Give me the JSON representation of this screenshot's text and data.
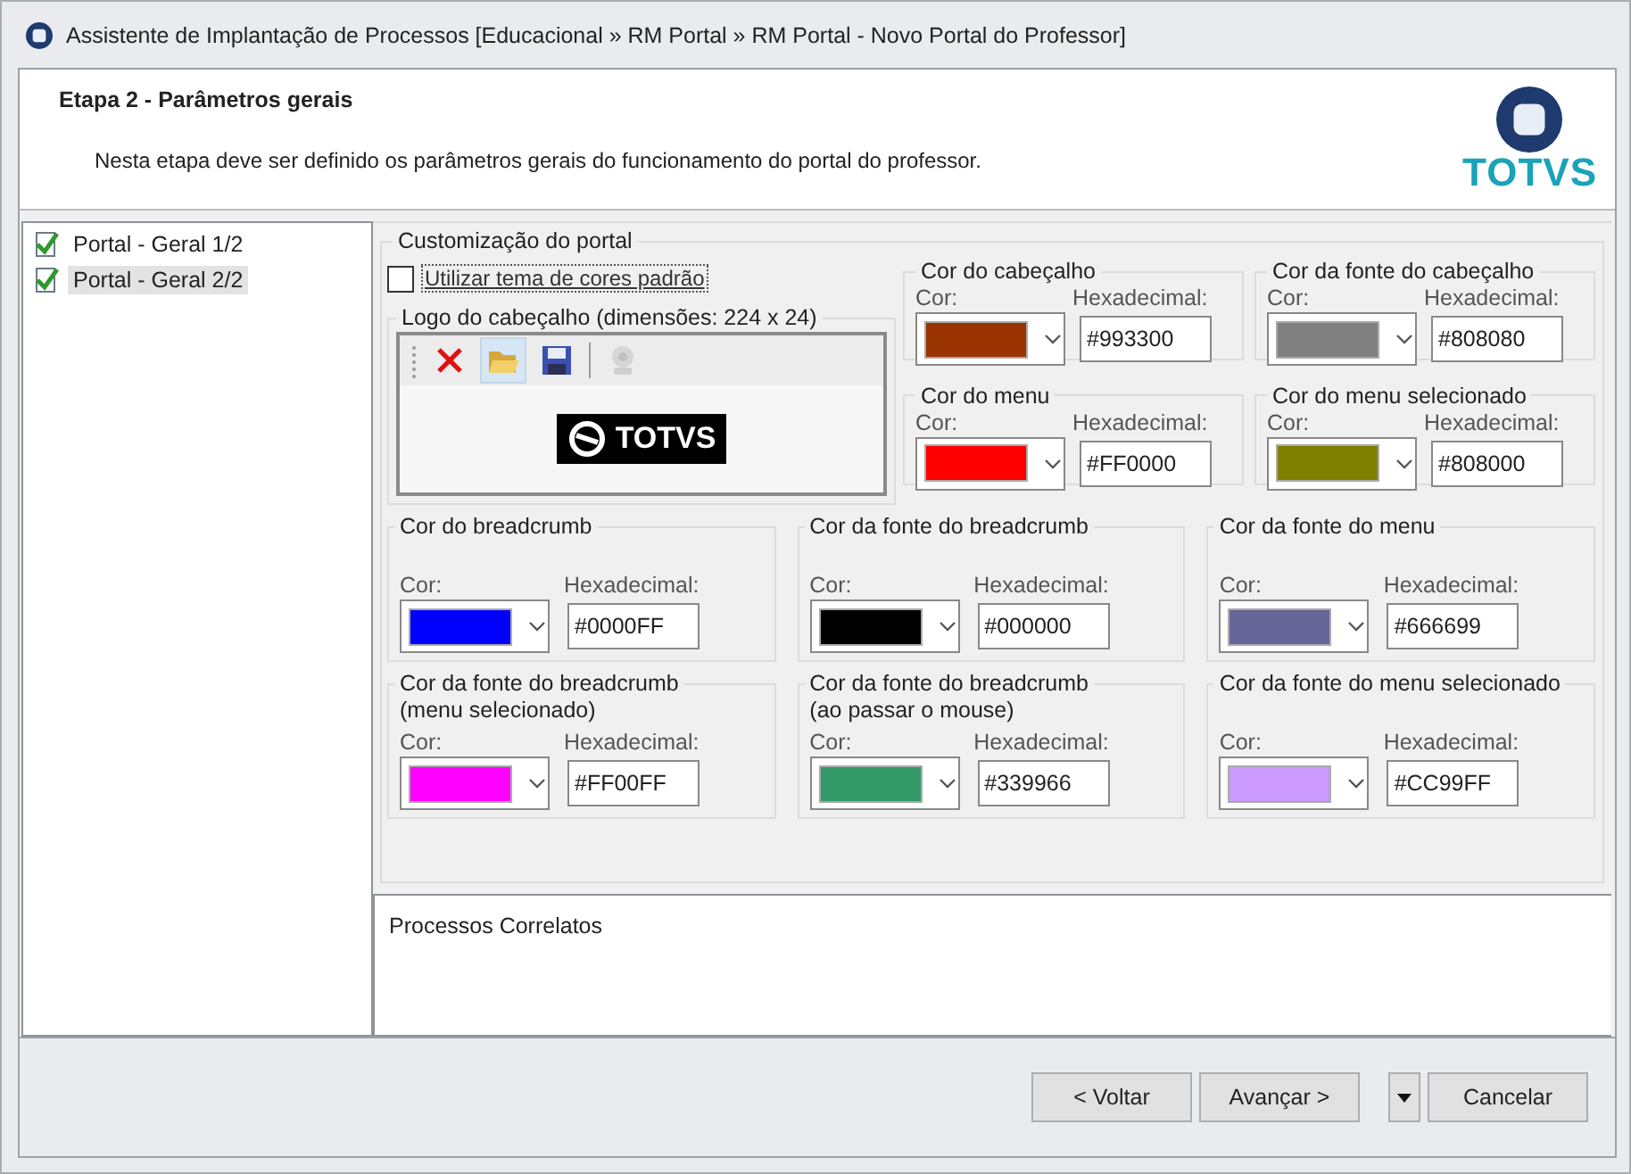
{
  "window": {
    "title": "Assistente de Implantação de Processos [Educacional » RM Portal » RM Portal - Novo Portal do Professor]"
  },
  "header": {
    "title": "Etapa 2 - Parâmetros gerais",
    "description": "Nesta etapa deve ser definido os parâmetros gerais do funcionamento do portal do professor.",
    "logo_text": "TOTVS"
  },
  "steps": [
    {
      "label": "Portal - Geral 1/2",
      "checked": true,
      "selected": false
    },
    {
      "label": "Portal - Geral 2/2",
      "checked": true,
      "selected": true
    }
  ],
  "customization": {
    "title": "Customização do portal",
    "default_theme": {
      "label": "Utilizar tema de cores padrão",
      "checked": false
    },
    "logo_group": {
      "title": "Logo do cabeçalho (dimensões: 224 x 24)",
      "preview_text": "TOTVS",
      "toolbar": [
        {
          "kind": "delete",
          "highlighted": false,
          "disabled": false
        },
        {
          "kind": "open",
          "highlighted": true,
          "disabled": false
        },
        {
          "kind": "save",
          "highlighted": false,
          "disabled": false
        },
        {
          "kind": "separator"
        },
        {
          "kind": "camera",
          "highlighted": false,
          "disabled": true
        }
      ]
    },
    "top_groups": [
      {
        "title": "Cor do cabeçalho",
        "color_label": "Cor:",
        "hex_label": "Hexadecimal:",
        "hex": "#993300",
        "color": "#993300"
      },
      {
        "title": "Cor da fonte do cabeçalho",
        "color_label": "Cor:",
        "hex_label": "Hexadecimal:",
        "hex": "#808080",
        "color": "#808080"
      },
      {
        "title": "Cor do menu",
        "color_label": "Cor:",
        "hex_label": "Hexadecimal:",
        "hex": "#FF0000",
        "color": "#ff0000"
      },
      {
        "title": "Cor do menu selecionado",
        "color_label": "Cor:",
        "hex_label": "Hexadecimal:",
        "hex": "#808000",
        "color": "#808000"
      }
    ],
    "groups": [
      {
        "title": "Cor do breadcrumb",
        "color_label": "Cor:",
        "hex_label": "Hexadecimal:",
        "hex": "#0000FF",
        "color": "#0000ff"
      },
      {
        "title": "Cor da fonte do breadcrumb",
        "color_label": "Cor:",
        "hex_label": "Hexadecimal:",
        "hex": "#000000",
        "color": "#000000"
      },
      {
        "title": "Cor da fonte do menu",
        "color_label": "Cor:",
        "hex_label": "Hexadecimal:",
        "hex": "#666699",
        "color": "#666699"
      },
      {
        "title": "Cor da fonte do breadcrumb\n(menu selecionado)",
        "color_label": "Cor:",
        "hex_label": "Hexadecimal:",
        "hex": "#FF00FF",
        "color": "#ff00ff"
      },
      {
        "title": "Cor da fonte do breadcrumb\n(ao passar o mouse)",
        "color_label": "Cor:",
        "hex_label": "Hexadecimal:",
        "hex": "#339966",
        "color": "#339966"
      },
      {
        "title": "Cor da fonte do menu selecionado",
        "color_label": "Cor:",
        "hex_label": "Hexadecimal:",
        "hex": "#CC99FF",
        "color": "#cc99ff"
      }
    ]
  },
  "related": {
    "title": "Processos Correlatos"
  },
  "buttons": [
    {
      "kind": "push",
      "label": "< Voltar"
    },
    {
      "kind": "push",
      "label": "Avançar >"
    },
    {
      "kind": "dropdown"
    },
    {
      "kind": "push",
      "label": "Cancelar"
    }
  ]
}
